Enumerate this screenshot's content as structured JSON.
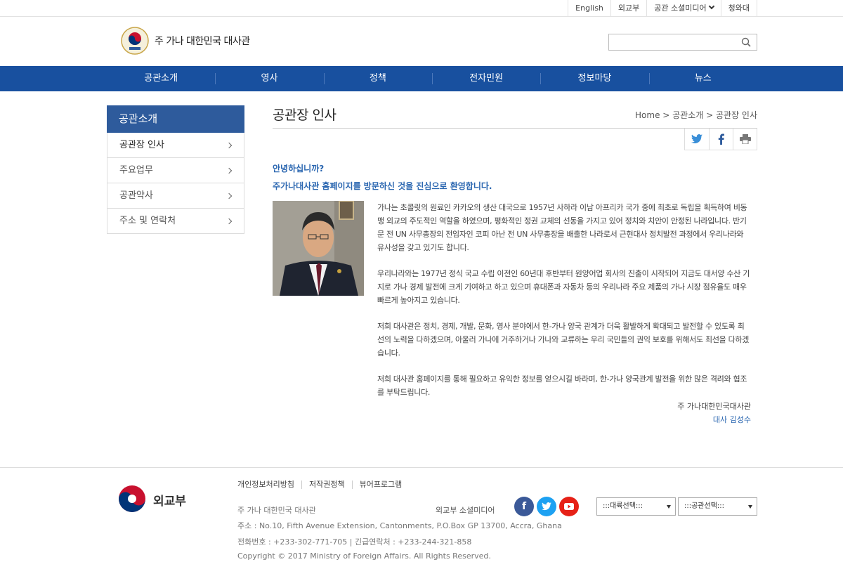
{
  "util_links": [
    "English",
    "외교부",
    "공관 소셜미디어",
    "청와대"
  ],
  "header": {
    "site_name": "주 가나 대한민국 대사관",
    "search_placeholder": ""
  },
  "nav": [
    "공관소개",
    "영사",
    "정책",
    "전자민원",
    "정보마당",
    "뉴스"
  ],
  "sidebar": {
    "title": "공관소개",
    "items": [
      {
        "label": "공관장 인사"
      },
      {
        "label": "주요업무"
      },
      {
        "label": "공관약사"
      },
      {
        "label": "주소 및 연락처"
      }
    ]
  },
  "content": {
    "title": "공관장 인사",
    "breadcrumb": "Home > 공관소개 > 공관장 인사",
    "greeting1": "안녕하십니까?",
    "greeting2": "주가나대사관 홈페이지를 방문하신 것을 진심으로 환영합니다.",
    "paragraphs": [
      "가나는 초콜릿의 원료인 카카오의 생산 대국으로 1957년 사하라 이남 아프리카 국가 중에 최초로 독립을 획득하여 비동맹 외교의 주도적인 역할을 하였으며, 평화적인 정권 교체의 선동을 가지고 있어 정치와 치안이 안정된 나라입니다. 반기문 전 UN 사무총장의 전임자인 코피 아난 전 UN 사무총장을 배출한 나라로서 근현대사 정치발전 과정에서 우리나라와 유사성을 갖고 있기도 합니다.",
      "우리나라와는 1977년 정식 국교 수립 이전인 60년대 후반부터 원양어업 회사의 진출이 시작되어 지금도 대서양 수산 기지로 가나 경제 발전에 크게 기여하고 하고 있으며 휴대폰과 자동차 등의 우리나라 주요 제품의 가나 시장 점유율도 매우 빠르게 높아지고 있습니다.",
      "저희 대사관은 정치, 경제, 개발, 문화, 영사 분야에서 한-가나 양국 관계가 더욱 활발하게 확대되고 발전할 수 있도록 최선의 노력을 다하겠으며, 아울러 가나에 거주하거나 가나와 교류하는 우리 국민들의 권익 보호를 위해서도 최선을 다하겠습니다.",
      "저희 대사관 홈페이지를 통해 필요하고 유익한 정보를 얻으시길 바라며, 한-가나 양국관계 발전을 위한 많은 격려와 협조를 부탁드립니다."
    ],
    "sign_org": "주 가나대한민국대사관",
    "sign_name": "대사 김성수"
  },
  "footer": {
    "logo_text": "외교부",
    "links": [
      "개인정보처리방침",
      "저작권정책",
      "뷰어프로그램"
    ],
    "embassy": "주 가나 대한민국 대사관",
    "address": "주소 : No.10, Fifth Avenue Extension, Cantonments, P.O.Box GP 13700, Accra, Ghana",
    "phone": "전화번호 : +233-302-771-705 | 긴급연락처 : +233-244-321-858",
    "copyright": "Copyright © 2017 Ministry of Foreign Affairs. All Rights Reserved.",
    "social_label": "외교부 소셜미디어",
    "select1": ":::대륙선택:::",
    "select2": ":::공관선택:::"
  },
  "colors": {
    "nav_bg": "#18509f",
    "sidebar_title_bg": "#2e5b9c",
    "accent_text": "#2a66b0",
    "facebook": "#3b5998",
    "twitter": "#1da1f2",
    "youtube": "#e62117"
  }
}
